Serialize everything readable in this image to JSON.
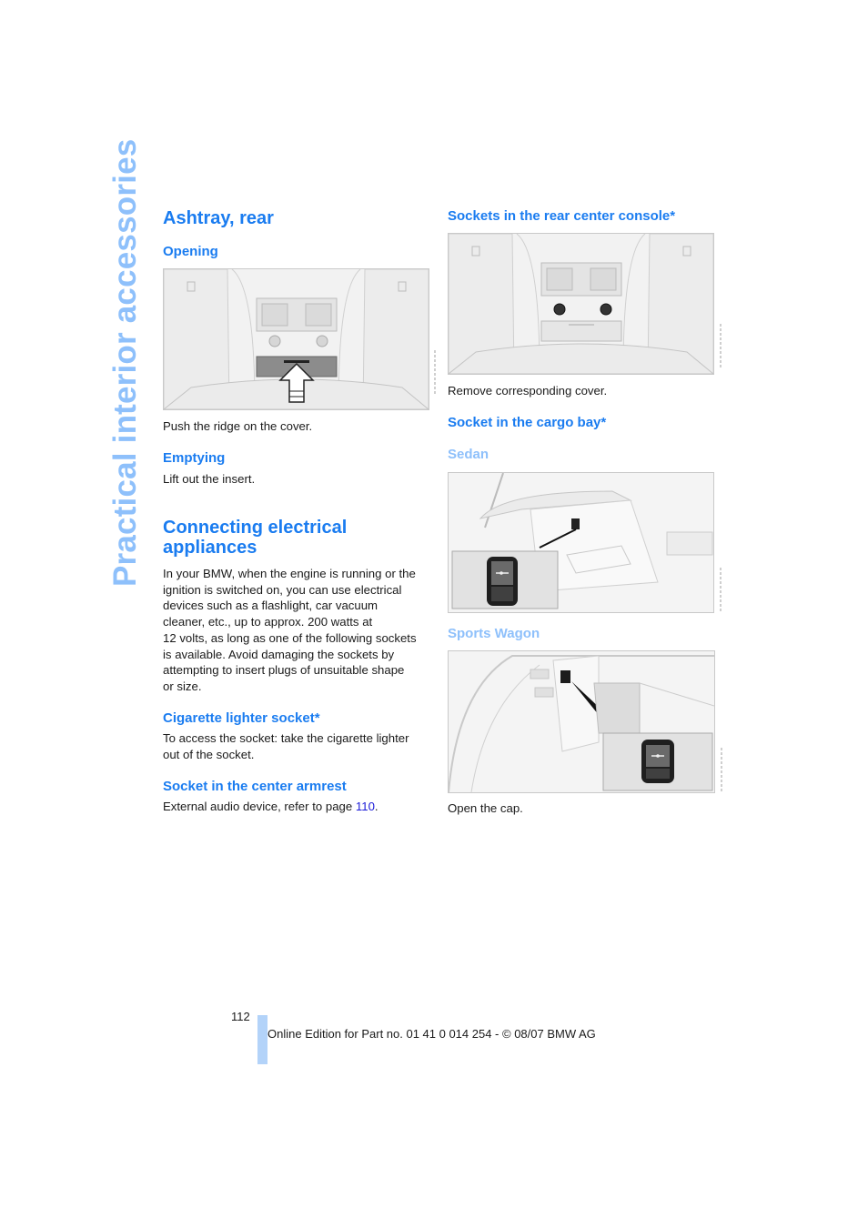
{
  "side_title": "Practical interior accessories",
  "left": {
    "ashtray": {
      "title": "Ashtray, rear",
      "opening_heading": "Opening",
      "opening_caption": "Push the ridge on the cover.",
      "emptying_heading": "Emptying",
      "emptying_text": "Lift out the insert."
    },
    "connecting": {
      "title_line1": "Connecting electrical",
      "title_line2": "appliances",
      "body_lines": [
        "In your BMW, when the engine is running or the",
        "ignition is switched on, you can use electrical",
        "devices such as a flashlight, car vacuum",
        "cleaner, etc., up to approx. 200 watts at",
        "12 volts, as long as one of the following sockets",
        "is available. Avoid damaging the sockets by",
        "attempting to insert plugs of unsuitable shape",
        "or size."
      ],
      "cigarette_heading": "Cigarette lighter socket*",
      "cigarette_lines": [
        "To access the socket: take the cigarette lighter",
        "out of the socket."
      ],
      "armrest_heading": "Socket in the center armrest",
      "armrest_text": "External audio device, refer to page ",
      "armrest_page_link": "110",
      "armrest_text_end": "."
    }
  },
  "right": {
    "console_heading": "Sockets in the rear center console*",
    "console_caption": "Remove corresponding cover.",
    "cargo_heading": "Socket in the cargo bay*",
    "sedan_heading": "Sedan",
    "wagon_heading": "Sports Wagon",
    "cargo_caption": "Open the cap."
  },
  "footer": {
    "page_number": "112",
    "edition": "Online Edition for Part no. 01 41 0 014 254 - © 08/07 BMW AG"
  },
  "colors": {
    "heading_blue": "#1a7cf0",
    "light_blue": "#8ec0fb",
    "link_blue": "#1a1ad8",
    "footer_bar": "#b3d3f9"
  }
}
